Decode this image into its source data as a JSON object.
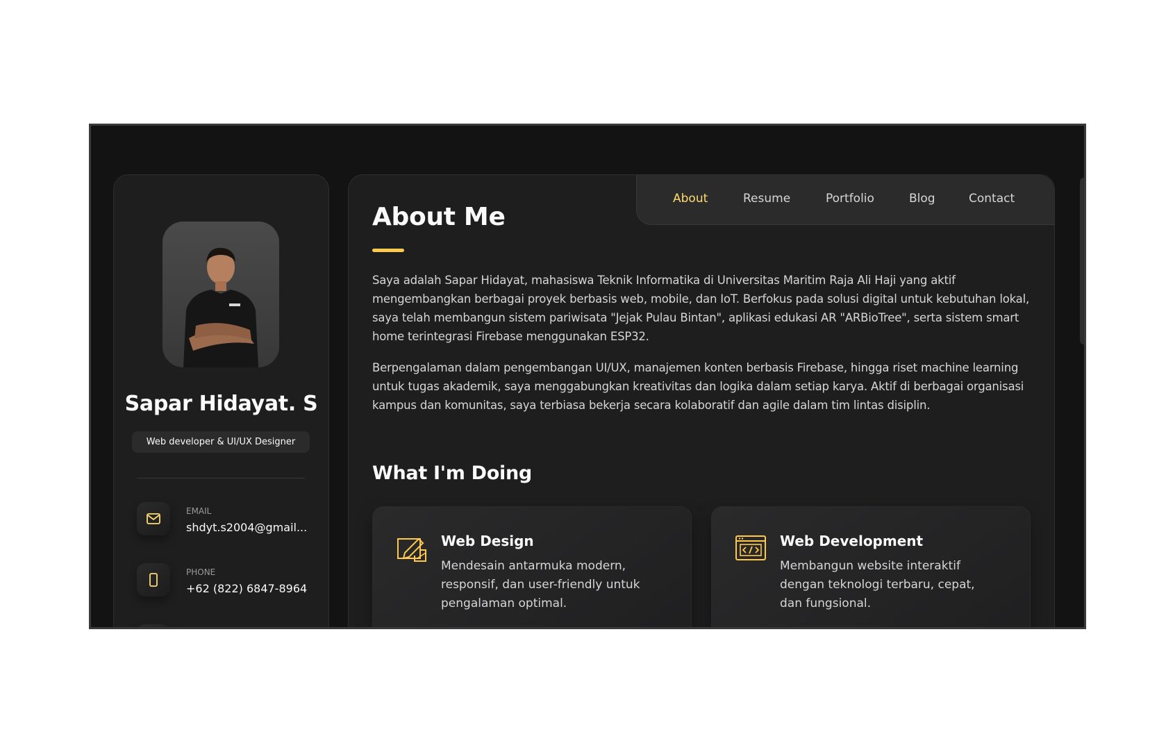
{
  "sidebar": {
    "name": "Sapar Hidayat. S",
    "title": "Web developer & UI/UX Designer",
    "contacts": [
      {
        "label": "Email",
        "value": "shdyt.s2004@gmail...",
        "icon": "mail-icon"
      },
      {
        "label": "Phone",
        "value": "+62 (822) 6847-8964",
        "icon": "phone-icon"
      }
    ]
  },
  "nav": {
    "items": [
      "About",
      "Resume",
      "Portfolio",
      "Blog",
      "Contact"
    ],
    "active": "About"
  },
  "about": {
    "title": "About Me",
    "paragraphs": [
      "Saya adalah Sapar Hidayat, mahasiswa Teknik Informatika di Universitas Maritim Raja Ali Haji yang aktif mengembangkan berbagai proyek berbasis web, mobile, dan IoT. Berfokus pada solusi digital untuk kebutuhan lokal, saya telah membangun sistem pariwisata \"Jejak Pulau Bintan\", aplikasi edukasi AR \"ARBioTree\", serta sistem smart home terintegrasi Firebase menggunakan ESP32.",
      "Berpengalaman dalam pengembangan UI/UX, manajemen konten berbasis Firebase, hingga riset machine learning untuk tugas akademik, saya menggabungkan kreativitas dan logika dalam setiap karya. Aktif di berbagai organisasi kampus dan komunitas, saya terbiasa bekerja secara kolaboratif dan agile dalam tim lintas disiplin."
    ]
  },
  "services": {
    "title": "What I'm Doing",
    "items": [
      {
        "title": "Web Design",
        "text": "Mendesain antarmuka modern, responsif, dan user-friendly untuk pengalaman optimal.",
        "icon": "design-icon"
      },
      {
        "title": "Web Development",
        "text": "Membangun website interaktif dengan teknologi terbaru, cepat, dan fungsional.",
        "icon": "code-icon"
      }
    ]
  },
  "colors": {
    "accent": "#ffdb70",
    "background": "#131313",
    "card": "#1e1e1f"
  }
}
